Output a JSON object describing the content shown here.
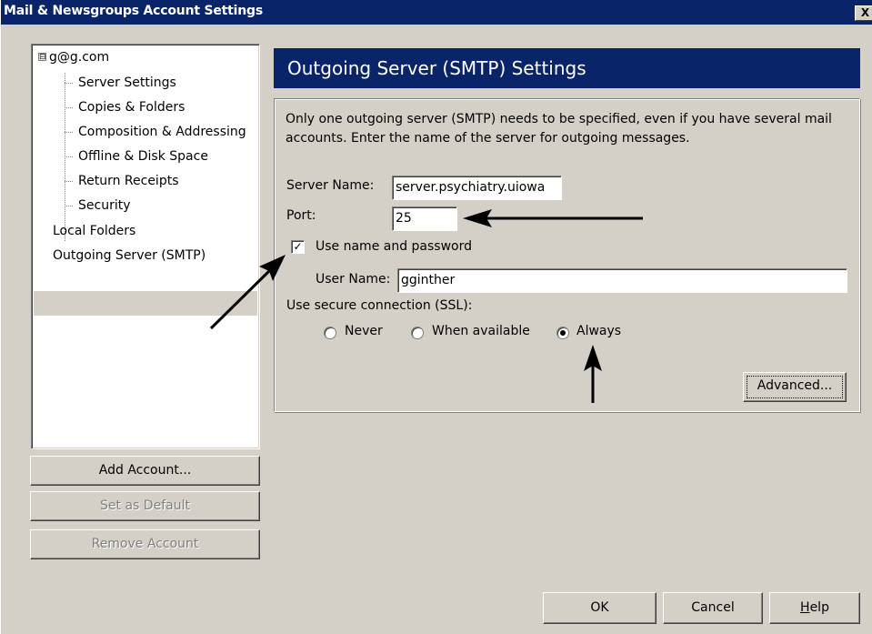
{
  "window": {
    "title": "Mail & Newsgroups Account Settings",
    "close_symbol": "X"
  },
  "tree": {
    "root_toggle": "⊟",
    "root": "g@g.com",
    "children": [
      "Server Settings",
      "Copies & Folders",
      "Composition & Addressing",
      "Offline & Disk Space",
      "Return Receipts",
      "Security"
    ],
    "local_folders": "Local Folders",
    "outgoing": "Outgoing Server (SMTP)"
  },
  "account_buttons": {
    "add": "Add Account...",
    "set_default": "Set as Default",
    "remove": "Remove Account"
  },
  "panel": {
    "title": "Outgoing Server (SMTP) Settings",
    "description": "Only one outgoing server (SMTP) needs to be specified, even if you have several mail accounts. Enter the name of the server for outgoing messages.",
    "server_name_label": "Server Name:",
    "server_name_value": "server.psychiatry.uiowa",
    "port_label": "Port:",
    "port_value": "25",
    "use_auth_label": "Use name and password",
    "use_auth_check": "✓",
    "user_name_label": "User Name:",
    "user_name_value": "gginther",
    "ssl_label": "Use secure connection (SSL):",
    "ssl_options": [
      "Never",
      "When available",
      "Always"
    ],
    "advanced": "Advanced..."
  },
  "dialog_buttons": {
    "ok": "OK",
    "cancel": "Cancel",
    "help": "Help",
    "help_accel": "H",
    "help_rest": "elp"
  }
}
